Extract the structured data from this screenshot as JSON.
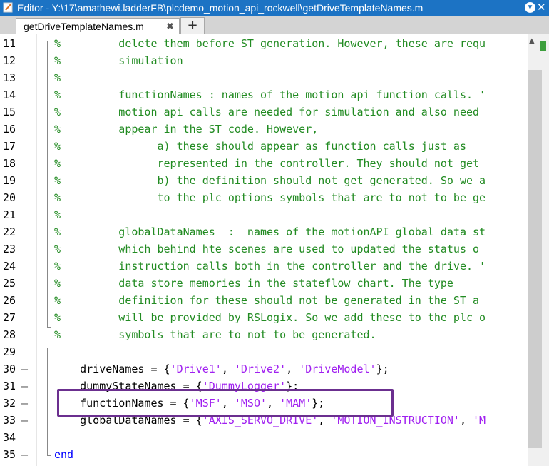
{
  "window": {
    "title": "Editor - Y:\\17\\amathewi.ladderFB\\plcdemo_motion_api_rockwell\\getDriveTemplateNames.m"
  },
  "tabs": [
    {
      "label": "getDriveTemplateNames.m",
      "close": "✖"
    }
  ],
  "add_tab_label": "+",
  "lines": [
    {
      "n": "11",
      "mark": "",
      "parts": [
        {
          "t": "%         delete them before ST generation. However, these are requ",
          "c": "c"
        }
      ]
    },
    {
      "n": "12",
      "mark": "",
      "parts": [
        {
          "t": "%         simulation",
          "c": "c"
        }
      ]
    },
    {
      "n": "13",
      "mark": "",
      "parts": [
        {
          "t": "%",
          "c": "c"
        }
      ]
    },
    {
      "n": "14",
      "mark": "",
      "parts": [
        {
          "t": "%         functionNames : names of the motion api function calls. '",
          "c": "c"
        }
      ]
    },
    {
      "n": "15",
      "mark": "",
      "parts": [
        {
          "t": "%         motion api calls are needed for simulation and also need",
          "c": "c"
        }
      ]
    },
    {
      "n": "16",
      "mark": "",
      "parts": [
        {
          "t": "%         appear in the ST code. However,",
          "c": "c"
        }
      ]
    },
    {
      "n": "17",
      "mark": "",
      "parts": [
        {
          "t": "%               a) these should appear as function calls just as",
          "c": "c"
        }
      ]
    },
    {
      "n": "18",
      "mark": "",
      "parts": [
        {
          "t": "%               represented in the controller. They should not get",
          "c": "c"
        }
      ]
    },
    {
      "n": "19",
      "mark": "",
      "parts": [
        {
          "t": "%               b) the definition should not get generated. So we a",
          "c": "c"
        }
      ]
    },
    {
      "n": "20",
      "mark": "",
      "parts": [
        {
          "t": "%               to the plc options symbols that are to not to be ge",
          "c": "c"
        }
      ]
    },
    {
      "n": "21",
      "mark": "",
      "parts": [
        {
          "t": "%",
          "c": "c"
        }
      ]
    },
    {
      "n": "22",
      "mark": "",
      "parts": [
        {
          "t": "%         globalDataNames  :  names of the motionAPI global data st",
          "c": "c"
        }
      ]
    },
    {
      "n": "23",
      "mark": "",
      "parts": [
        {
          "t": "%         which behind hte scenes are used to updated the status o",
          "c": "c"
        }
      ]
    },
    {
      "n": "24",
      "mark": "",
      "parts": [
        {
          "t": "%         instruction calls both in the controller and the drive. '",
          "c": "c"
        }
      ]
    },
    {
      "n": "25",
      "mark": "",
      "parts": [
        {
          "t": "%         data store memories in the stateflow chart. The type",
          "c": "c"
        }
      ]
    },
    {
      "n": "26",
      "mark": "",
      "parts": [
        {
          "t": "%         definition for these should not be generated in the ST a",
          "c": "c"
        }
      ]
    },
    {
      "n": "27",
      "mark": "",
      "parts": [
        {
          "t": "%         will be provided by RSLogix. So we add these to the plc o",
          "c": "c"
        }
      ]
    },
    {
      "n": "28",
      "mark": "",
      "parts": [
        {
          "t": "%         symbols that are to not to be generated.",
          "c": "c"
        }
      ]
    },
    {
      "n": "29",
      "mark": "",
      "parts": []
    },
    {
      "n": "30",
      "mark": "–",
      "parts": [
        {
          "t": "    driveNames = {",
          "c": ""
        },
        {
          "t": "'Drive1'",
          "c": "s"
        },
        {
          "t": ", ",
          "c": ""
        },
        {
          "t": "'Drive2'",
          "c": "s"
        },
        {
          "t": ", ",
          "c": ""
        },
        {
          "t": "'DriveModel'",
          "c": "s"
        },
        {
          "t": "};",
          "c": ""
        }
      ]
    },
    {
      "n": "31",
      "mark": "–",
      "parts": [
        {
          "t": "    dummyStateNames = {",
          "c": ""
        },
        {
          "t": "'DummyLogger'",
          "c": "s"
        },
        {
          "t": "};",
          "c": ""
        }
      ]
    },
    {
      "n": "32",
      "mark": "–",
      "parts": [
        {
          "t": "    functionNames = {",
          "c": ""
        },
        {
          "t": "'MSF'",
          "c": "s"
        },
        {
          "t": ", ",
          "c": ""
        },
        {
          "t": "'MSO'",
          "c": "s"
        },
        {
          "t": ", ",
          "c": ""
        },
        {
          "t": "'MAM'",
          "c": "s"
        },
        {
          "t": "};",
          "c": ""
        }
      ]
    },
    {
      "n": "33",
      "mark": "–",
      "parts": [
        {
          "t": "    globalDataNames = {",
          "c": ""
        },
        {
          "t": "'AXIS_SERVO_DRIVE'",
          "c": "s"
        },
        {
          "t": ", ",
          "c": ""
        },
        {
          "t": "'MOTION_INSTRUCTION'",
          "c": "s"
        },
        {
          "t": ", ",
          "c": ""
        },
        {
          "t": "'M",
          "c": "s"
        }
      ]
    },
    {
      "n": "34",
      "mark": "",
      "parts": []
    },
    {
      "n": "35",
      "mark": "–",
      "parts": [
        {
          "t": "end",
          "c": "k"
        }
      ]
    }
  ]
}
